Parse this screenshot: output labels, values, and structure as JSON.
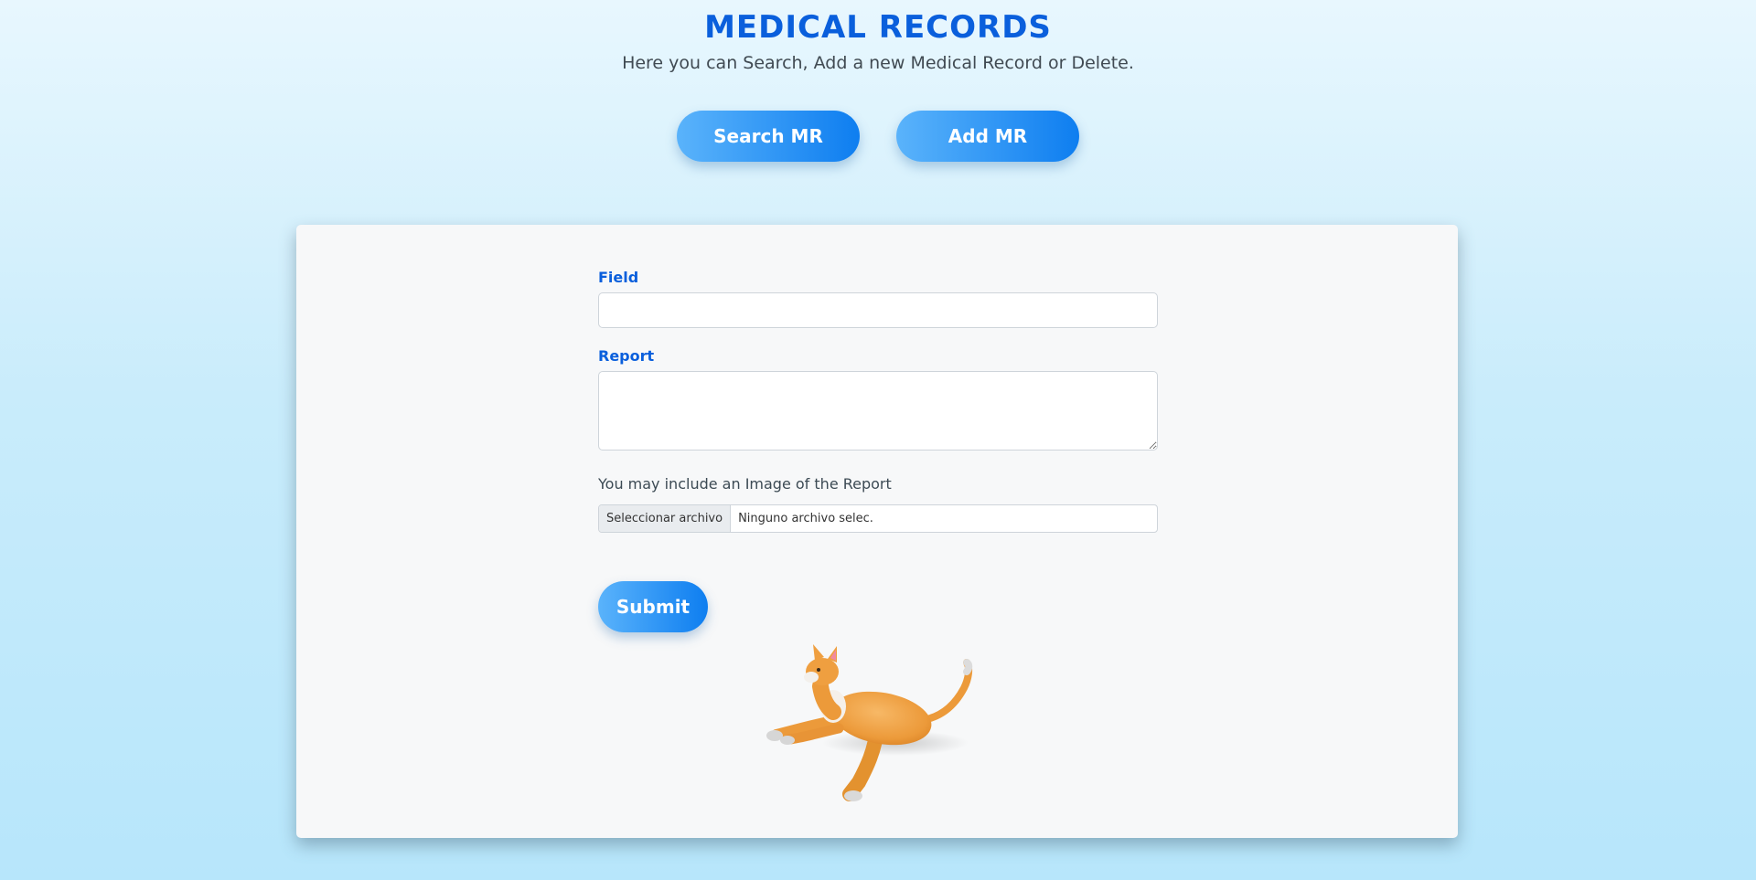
{
  "header": {
    "title": "MEDICAL RECORDS",
    "subtitle": "Here you can Search, Add a new Medical Record or Delete."
  },
  "actions": {
    "search_label": "Search MR",
    "add_label": "Add MR"
  },
  "form": {
    "field_label": "Field",
    "field_value": "",
    "report_label": "Report",
    "report_value": "",
    "image_note": "You may include an Image of the Report",
    "file_choose_label": "Seleccionar archivo",
    "file_status": "Ninguno archivo selec.",
    "submit_label": "Submit"
  },
  "illustration": {
    "icon": "cat-illustration"
  },
  "colors": {
    "accent": "#0a5fdc",
    "button_start": "#5ab3fb",
    "button_end": "#0e7ef0",
    "card_bg": "#f7f8f9"
  }
}
